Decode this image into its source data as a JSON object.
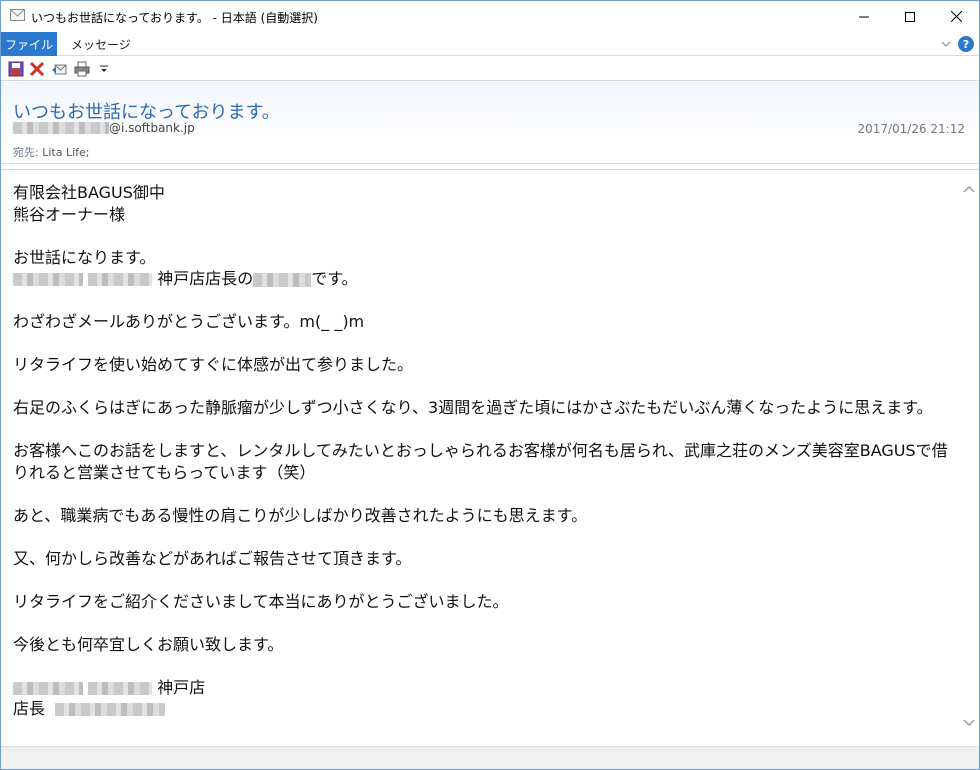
{
  "window": {
    "title": "いつもお世話になっております。 - 日本語 (自動選択)"
  },
  "ribbon": {
    "file_tab": "ファイル",
    "message_tab": "メッセージ",
    "help_label": "?"
  },
  "header": {
    "subject": "いつもお世話になっております。",
    "sender_domain": "@i.softbank.jp",
    "date": "2017/01/26 21:12",
    "to_label": "宛先:",
    "to_value": "Lita Life;"
  },
  "body": {
    "line1": "有限会社BAGUS御中",
    "line2": "熊谷オーナー様",
    "line3": "お世話になります。",
    "line4_suffix": "神戸店店長の",
    "line4_end": "です。",
    "line5": "わざわざメールありがとうございます。m(_ _)m",
    "line6": "リタライフを使い始めてすぐに体感が出て参りました。",
    "line7": "右足のふくらはぎにあった静脈瘤が少しずつ小さくなり、3週間を過ぎた頃にはかさぶたもだいぶん薄くなったように思えます。",
    "line8": "お客様へこのお話をしますと、レンタルしてみたいとおっしゃられるお客様が何名も居られ、武庫之荘のメンズ美容室BAGUSで借りれると営業させてもらっています（笑）",
    "line9": "あと、職業病でもある慢性の肩こりが少しばかり改善されたようにも思えます。",
    "line10": "又、何かしら改善などがあればご報告させて頂きます。",
    "line11": "リタライフをご紹介くださいまして本当にありがとうございました。",
    "line12": "今後とも何卒宜しくお願い致します。",
    "sig_store": "神戸店",
    "sig_title": "店長"
  }
}
